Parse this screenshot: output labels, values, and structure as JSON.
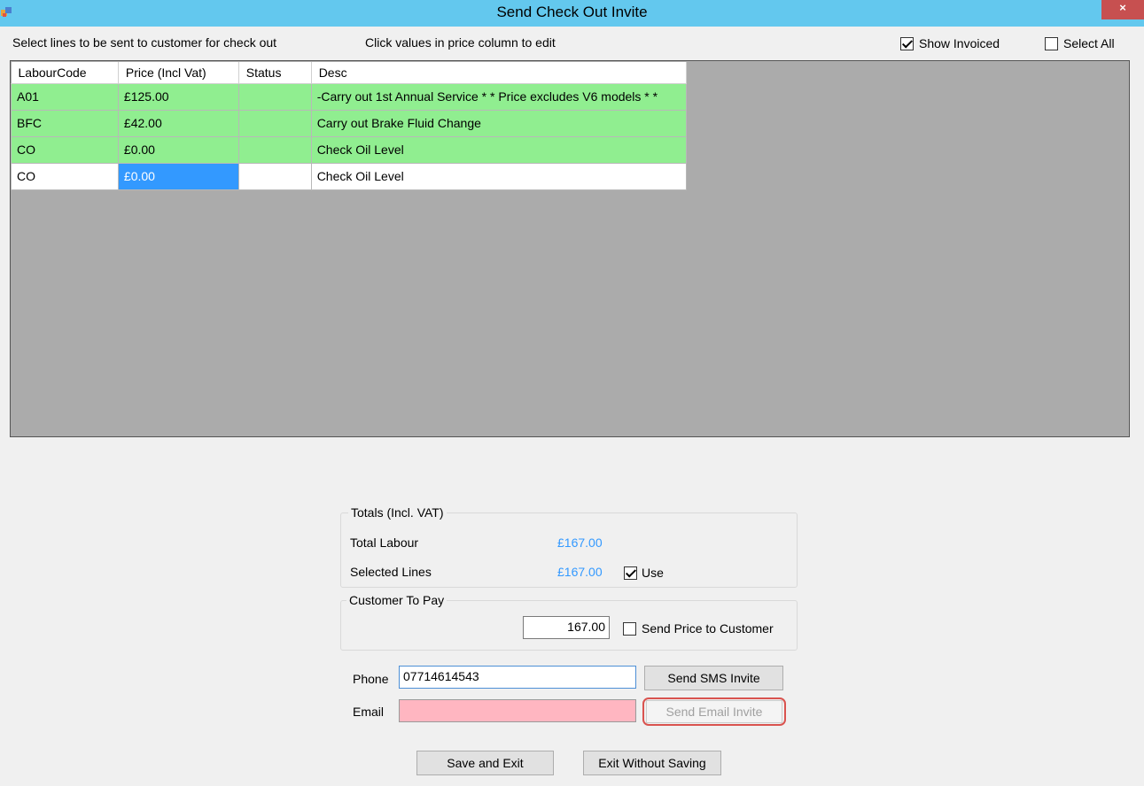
{
  "window": {
    "title": "Send Check Out Invite",
    "close_glyph": "×"
  },
  "instructions": {
    "select_lines": "Select lines to be sent to customer for check out",
    "click_values": "Click values in price column to edit"
  },
  "options": {
    "show_invoiced_label": "Show Invoiced",
    "show_invoiced_checked": true,
    "select_all_label": "Select All",
    "select_all_checked": false
  },
  "grid": {
    "columns": [
      "LabourCode",
      "Price (Incl Vat)",
      "Status",
      "Desc"
    ],
    "rows": [
      {
        "code": "A01",
        "price": "£125.00",
        "status": "",
        "desc": "-Carry out 1st Annual Service  * * Price excludes V6 models * *",
        "selected": true
      },
      {
        "code": "BFC",
        "price": "£42.00",
        "status": "",
        "desc": "Carry out Brake Fluid Change",
        "selected": true
      },
      {
        "code": "CO",
        "price": "£0.00",
        "status": "",
        "desc": "Check Oil Level",
        "selected": true
      },
      {
        "code": "CO",
        "price": "£0.00",
        "status": "",
        "desc": "Check Oil Level",
        "selected": false
      }
    ]
  },
  "totals": {
    "group_title": "Totals (Incl. VAT)",
    "total_labour_label": "Total Labour",
    "total_labour_value": "£167.00",
    "selected_lines_label": "Selected Lines",
    "selected_lines_value": "£167.00",
    "use_label": "Use",
    "use_checked": true
  },
  "customer_to_pay": {
    "group_title": "Customer To Pay",
    "amount": "167.00",
    "send_price_label": "Send Price to Customer",
    "send_price_checked": false
  },
  "contact": {
    "phone_label": "Phone",
    "phone_value": "07714614543",
    "email_label": "Email",
    "email_value": "",
    "send_sms_label": "Send SMS Invite",
    "send_email_label": "Send Email Invite"
  },
  "footer": {
    "save_exit_label": "Save and Exit",
    "exit_no_save_label": "Exit Without Saving"
  },
  "colors": {
    "titlebar": "#63c8ee",
    "row_selected": "#90ee90",
    "cell_focus": "#3399ff",
    "email_invalid": "#ffb6c1",
    "highlight": "#d9534f"
  }
}
